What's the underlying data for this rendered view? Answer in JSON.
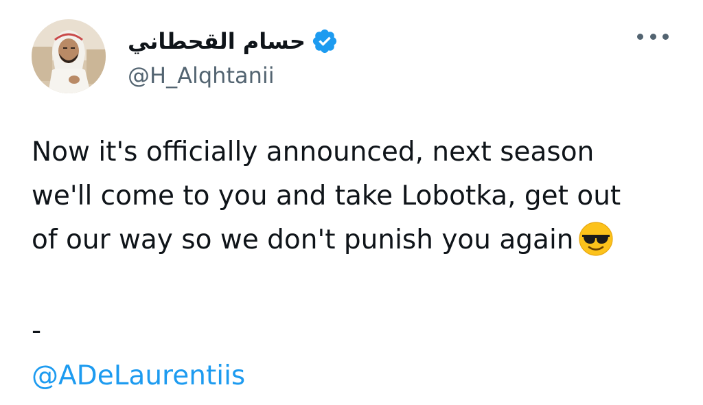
{
  "author": {
    "display_name": "حسام القحطاني",
    "handle": "@H_Alqhtanii",
    "verified": true,
    "verified_icon": "verified-badge-icon",
    "avatar": "profile-photo"
  },
  "more_icon": "more-options-icon",
  "tweet": {
    "lines": [
      "Now it's officially announced, next season",
      "we'll come to you and take Lobotka, get out",
      "of our way so we don't punish you again"
    ],
    "emoji": "smiling-face-with-sunglasses",
    "separator": "-",
    "mention": "@ADeLaurentiis"
  },
  "colors": {
    "text": "#0f1419",
    "secondary": "#536471",
    "accent": "#1d9bf0"
  }
}
